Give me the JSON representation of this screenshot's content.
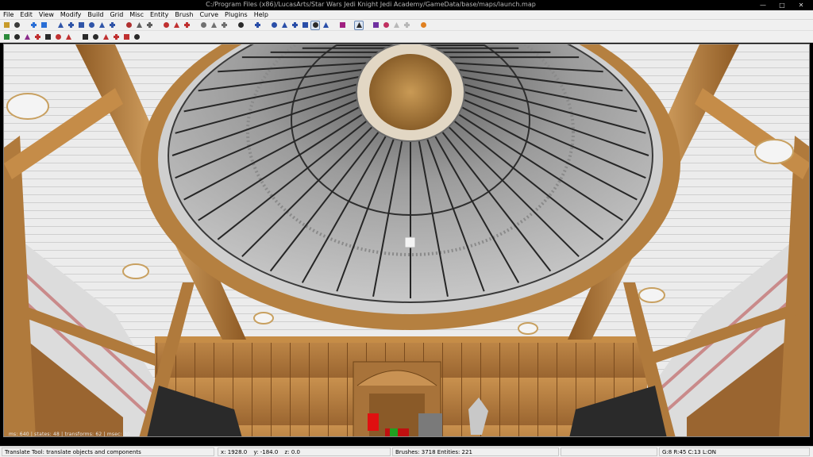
{
  "window": {
    "title": "C:/Program Files (x86)/LucasArts/Star Wars Jedi Knight Jedi Academy/GameData/base/maps/launch.map",
    "controls": {
      "minimize": "—",
      "maximize": "□",
      "close": "✕"
    }
  },
  "menu": [
    "File",
    "Edit",
    "View",
    "Modify",
    "Build",
    "Grid",
    "Misc",
    "Entity",
    "Brush",
    "Curve",
    "Plugins",
    "Help"
  ],
  "toolbar_top": [
    {
      "name": "open-icon",
      "color": "#c89b2a"
    },
    {
      "name": "save-icon",
      "color": "#3a3a3a"
    },
    {
      "name": "sep"
    },
    {
      "name": "arrow-left-icon",
      "color": "#2a6fd6"
    },
    {
      "name": "arrow-right-icon",
      "color": "#2a6fd6"
    },
    {
      "name": "sep"
    },
    {
      "name": "flip-x-icon",
      "color": "#3055a8"
    },
    {
      "name": "rotate-x-icon",
      "color": "#3055a8"
    },
    {
      "name": "flip-y-icon",
      "color": "#3055a8"
    },
    {
      "name": "rotate-y-icon",
      "color": "#3055a8"
    },
    {
      "name": "flip-z-icon",
      "color": "#3055a8"
    },
    {
      "name": "rotate-z-icon",
      "color": "#3055a8"
    },
    {
      "name": "sep"
    },
    {
      "name": "brush-icon",
      "color": "#b03030"
    },
    {
      "name": "csg-icon",
      "color": "#606060"
    },
    {
      "name": "hollow-icon",
      "color": "#606060"
    },
    {
      "name": "sep"
    },
    {
      "name": "select-inside-icon",
      "color": "#c03030"
    },
    {
      "name": "select-touching-icon",
      "color": "#c03030"
    },
    {
      "name": "select-partial-icon",
      "color": "#c03030"
    },
    {
      "name": "sep"
    },
    {
      "name": "view-xy-icon",
      "color": "#707070"
    },
    {
      "name": "view-xz-icon",
      "color": "#707070"
    },
    {
      "name": "view-yz-icon",
      "color": "#707070"
    },
    {
      "name": "sep"
    },
    {
      "name": "pointer-icon",
      "color": "#2a2a2a"
    },
    {
      "name": "sep"
    },
    {
      "name": "camera-icon",
      "color": "#2a4ea8"
    },
    {
      "name": "sep"
    },
    {
      "name": "patch-icon",
      "color": "#2a4ea8"
    },
    {
      "name": "patch-bend-icon",
      "color": "#2a4ea8"
    },
    {
      "name": "patch-insert-icon",
      "color": "#2a4ea8"
    },
    {
      "name": "clipper-icon",
      "color": "#2a4ea8"
    },
    {
      "name": "qe-button",
      "color": "#2a2a2a",
      "pressed": true
    },
    {
      "name": "vertex-icon",
      "color": "#2a4ea8"
    },
    {
      "name": "sep"
    },
    {
      "name": "paint-icon",
      "color": "#a02080"
    },
    {
      "name": "sep"
    },
    {
      "name": "texture-lock-icon",
      "color": "#2a2a2a",
      "pressed": true
    },
    {
      "name": "sep"
    },
    {
      "name": "entity-icon",
      "color": "#7030a0"
    },
    {
      "name": "filter-icon",
      "color": "#c03060"
    },
    {
      "name": "disabled-icon",
      "color": "#b8b8b8"
    },
    {
      "name": "disabled2-icon",
      "color": "#b8b8b8"
    },
    {
      "name": "sep"
    },
    {
      "name": "plugin-icon",
      "color": "#e08020"
    }
  ],
  "toolbar_bottom": [
    {
      "name": "refresh-icon",
      "color": "#2a8a3a"
    },
    {
      "name": "select-ring-icon",
      "color": "#2a2a2a"
    },
    {
      "name": "texture-icon",
      "color": "#8a2a8a"
    },
    {
      "name": "region-icon",
      "color": "#c03030"
    },
    {
      "name": "cube-icon",
      "color": "#2a2a2a"
    },
    {
      "name": "face-icon",
      "color": "#c03030"
    },
    {
      "name": "edge-icon",
      "color": "#c03030"
    },
    {
      "name": "sep"
    },
    {
      "name": "move-up-icon",
      "color": "#2a2a2a"
    },
    {
      "name": "move-down-icon",
      "color": "#2a2a2a"
    },
    {
      "name": "scale-icon",
      "color": "#c03030"
    },
    {
      "name": "rotate-icon",
      "color": "#c03030"
    },
    {
      "name": "drag-icon",
      "color": "#c03030"
    },
    {
      "name": "deselect-icon",
      "color": "#2a2a2a"
    }
  ],
  "viewport": {
    "readout": "ms: 640 | states: 48 | transforms: 62 | msec: 30"
  },
  "status": {
    "tool": "Translate Tool: translate objects and components",
    "x_label": "x:",
    "x_value": "1928.0",
    "y_label": "y:",
    "y_value": "-184.0",
    "z_label": "z:",
    "z_value": "0.0",
    "brushes": "Brushes: 3718 Entities: 221",
    "grid": "G:8  R:45  C:13  L:ON"
  },
  "colors": {
    "wood": "#b07a3c",
    "wood_light": "#d9a866",
    "dome": "#8c8c8c",
    "medallion": "#b98a48",
    "stripe": "#c98a8a",
    "ceiling": "#eeeeee"
  }
}
